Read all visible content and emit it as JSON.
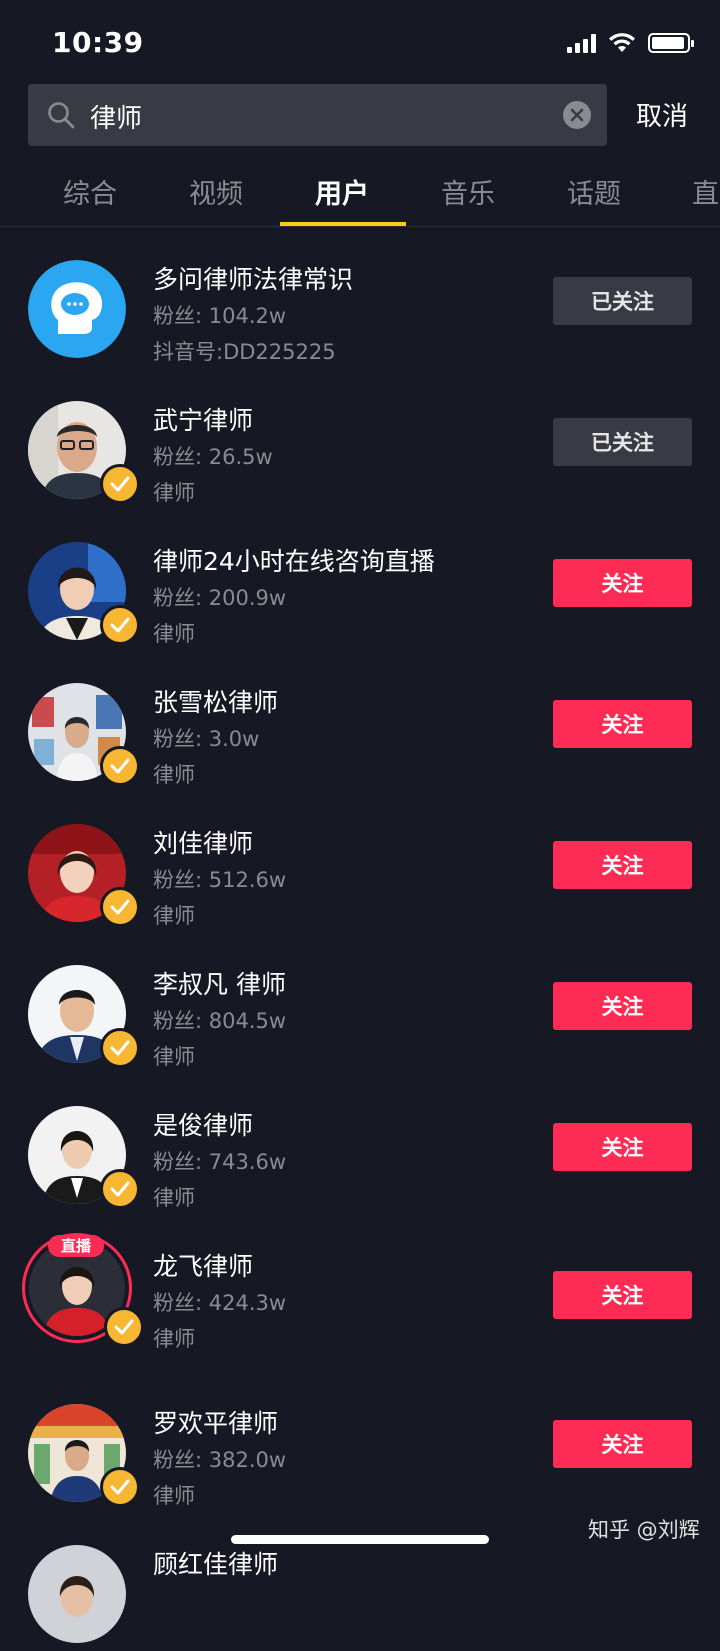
{
  "status": {
    "time": "10:39"
  },
  "search": {
    "query": "律师",
    "cancel_label": "取消"
  },
  "tabs": [
    {
      "label": "综合"
    },
    {
      "label": "视频"
    },
    {
      "label": "用户"
    },
    {
      "label": "音乐"
    },
    {
      "label": "话题"
    },
    {
      "label": "直"
    }
  ],
  "active_tab": "用户",
  "results": [
    {
      "name": "多问律师法律常识",
      "fans": "粉丝: 104.2w",
      "sub": "抖音号:DD225225",
      "button": "已关注"
    },
    {
      "name": "武宁律师",
      "fans": "粉丝: 26.5w",
      "sub": "律师",
      "button": "已关注"
    },
    {
      "name": "律师24小时在线咨询直播",
      "fans": "粉丝: 200.9w",
      "sub": "律师",
      "button": "关注"
    },
    {
      "name": "张雪松律师",
      "fans": "粉丝: 3.0w",
      "sub": "律师",
      "button": "关注"
    },
    {
      "name": "刘佳律师",
      "fans": "粉丝: 512.6w",
      "sub": "律师",
      "button": "关注"
    },
    {
      "name": "李叔凡 律师",
      "fans": "粉丝: 804.5w",
      "sub": "律师",
      "button": "关注"
    },
    {
      "name": "是俊律师",
      "fans": "粉丝: 743.6w",
      "sub": "律师",
      "button": "关注"
    },
    {
      "name": "龙飞律师",
      "fans": "粉丝: 424.3w",
      "sub": "律师",
      "button": "关注",
      "live_label": "直播"
    },
    {
      "name": "罗欢平律师",
      "fans": "粉丝: 382.0w",
      "sub": "律师",
      "button": "关注"
    },
    {
      "name": "顾红佳律师"
    }
  ],
  "watermark": "知乎 @刘辉",
  "colors": {
    "background": "#161823",
    "accent_red": "#fe2c55",
    "tab_underline": "#face15",
    "verified_badge": "#f7b733"
  }
}
